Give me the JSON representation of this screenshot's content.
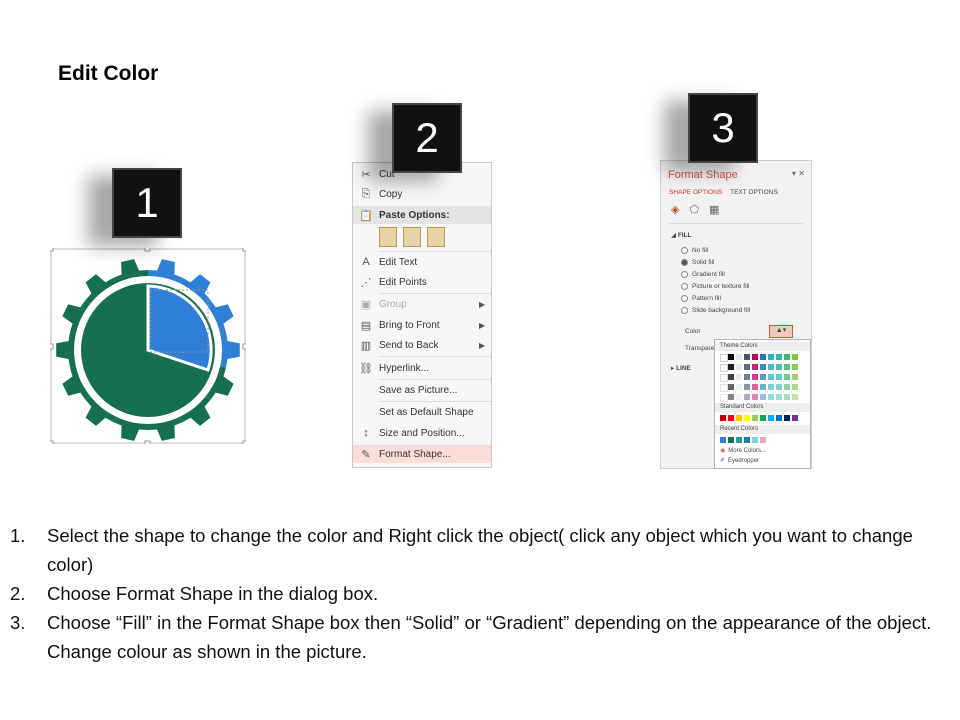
{
  "title": "Edit Color",
  "steps": {
    "badge1": "1",
    "badge2": "2",
    "badge3": "3"
  },
  "context_menu": {
    "items": [
      {
        "icon": "scissors-icon",
        "glyph": "✂",
        "label": "Cut"
      },
      {
        "icon": "copy-icon",
        "glyph": "⎘",
        "label": "Copy"
      },
      {
        "icon": "paste-icon",
        "glyph": "📋",
        "label": "Paste Options:"
      },
      {
        "icon": "edit-text-icon",
        "glyph": "A",
        "label": "Edit Text"
      },
      {
        "icon": "edit-points-icon",
        "glyph": "⋰",
        "label": "Edit Points"
      },
      {
        "icon": "group-icon",
        "glyph": "▣",
        "label": "Group"
      },
      {
        "icon": "bring-to-front-icon",
        "glyph": "▤",
        "label": "Bring to Front"
      },
      {
        "icon": "send-to-back-icon",
        "glyph": "▥",
        "label": "Send to Back"
      },
      {
        "icon": "hyperlink-icon",
        "glyph": "⛓",
        "label": "Hyperlink..."
      },
      {
        "icon": "",
        "glyph": "",
        "label": "Save as Picture..."
      },
      {
        "icon": "",
        "glyph": "",
        "label": "Set as Default Shape"
      },
      {
        "icon": "size-position-icon",
        "glyph": "↕",
        "label": "Size and Position..."
      },
      {
        "icon": "format-shape-icon",
        "glyph": "✎",
        "label": "Format Shape..."
      }
    ]
  },
  "format_pane": {
    "title": "Format Shape",
    "close": "✕",
    "dropdown": "▾",
    "tab_shape": "SHAPE OPTIONS",
    "tab_text": "TEXT OPTIONS",
    "fill_section": "FILL",
    "fill_options": [
      "No fill",
      "Solid fill",
      "Gradient fill",
      "Picture or texture fill",
      "Pattern fill",
      "Slide background fill"
    ],
    "color_label": "Color",
    "transparency_label": "Transparency",
    "line_section": "LINE",
    "palette": {
      "theme_colors": "Theme Colors",
      "standard_colors": "Standard Colors",
      "recent_colors": "Recent Colors",
      "more_colors": "More Colors...",
      "eyedropper": "Eyedropper"
    }
  },
  "colors": {
    "gear_green": "#16704f",
    "gear_blue": "#2f7fd6",
    "accent": "#d0573e",
    "theme_row": [
      "#ffffff",
      "#000000",
      "#e7e6e6",
      "#44546a",
      "#c00060",
      "#1f7aa8",
      "#2fb0c0",
      "#33b8a8",
      "#3fb870",
      "#80c040"
    ],
    "standard_row": [
      "#c00000",
      "#ff0000",
      "#ffc000",
      "#ffff00",
      "#92d050",
      "#00b050",
      "#00b0f0",
      "#0070c0",
      "#002060",
      "#7030a0"
    ],
    "recent_row": [
      "#2f7fd6",
      "#16704f",
      "#20a090",
      "#1f7aa8",
      "#7fd0e0",
      "#f0a0c0"
    ]
  },
  "instructions": [
    {
      "num": "1.",
      "text": "Select the shape to change the color and Right click the object( click any object which you want to change color)"
    },
    {
      "num": "2.",
      "text": "Choose Format Shape in the dialog box."
    },
    {
      "num": "3.",
      "text": "Choose “Fill” in the Format Shape box then “Solid” or “Gradient” depending on the appearance of the object. Change colour as shown in the picture."
    }
  ]
}
